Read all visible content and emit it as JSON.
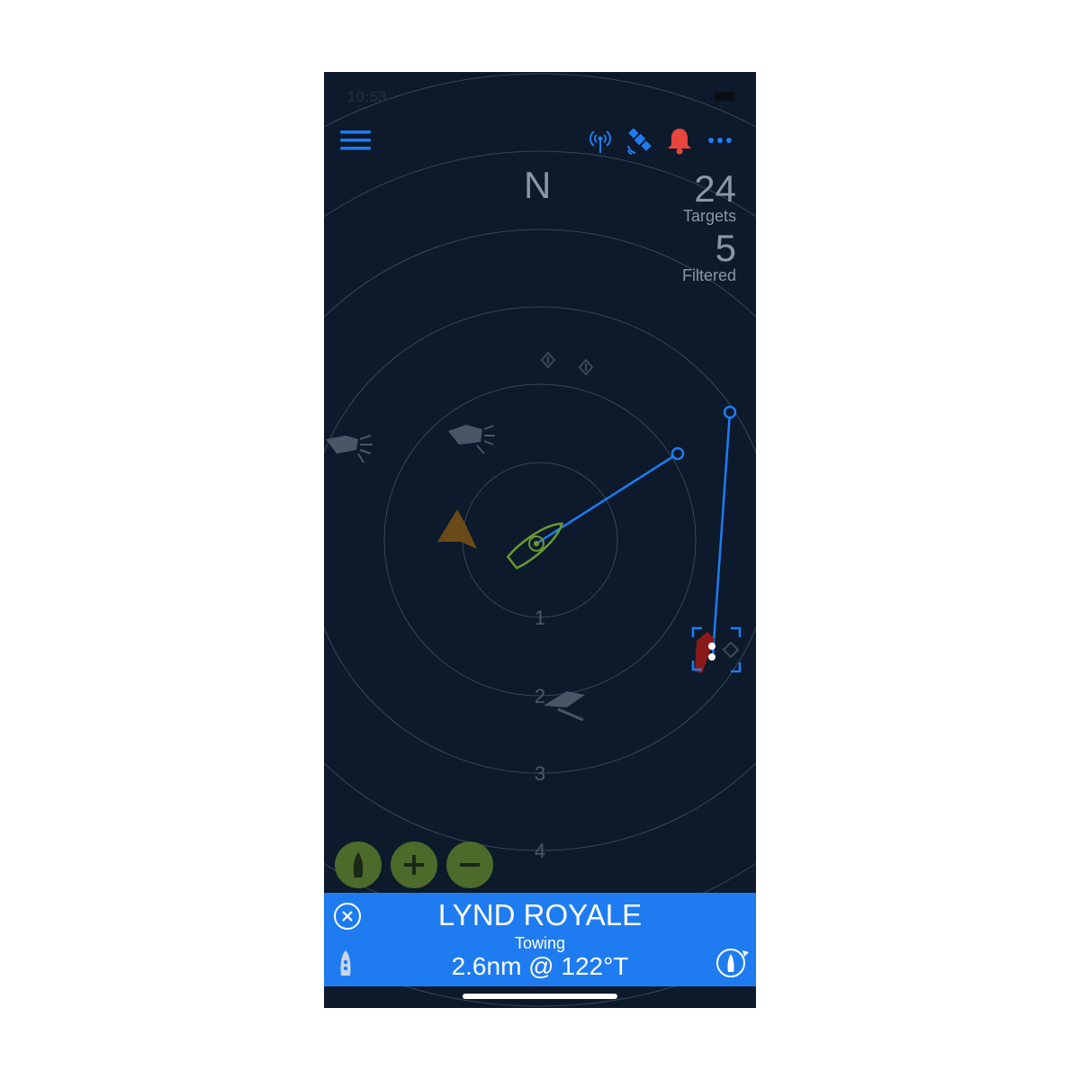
{
  "status_bar": {
    "time": "10:53"
  },
  "header": {
    "menu_icon": "hamburger-menu-icon",
    "ais_icon": "antenna-icon",
    "gps_icon": "satellite-icon",
    "alarm_icon": "bell-icon",
    "more_icon": "more-dots-icon"
  },
  "radar": {
    "heading_label": "N",
    "ring_labels": [
      "1",
      "2",
      "3",
      "4"
    ],
    "colors": {
      "background": "#0c1a2b",
      "ring": "#3a4657",
      "vector": "#1e7cf0",
      "own_ship": "#6a9a30",
      "target_faded": "#4a5566",
      "selected_target": "#8a1a1a",
      "sailboat": "#6a4a18"
    }
  },
  "counts": {
    "targets_value": "24",
    "targets_label": "Targets",
    "filtered_value": "5",
    "filtered_label": "Filtered"
  },
  "controls": {
    "center_icon": "own-boat-center-icon",
    "zoom_in_icon": "plus-icon",
    "zoom_out_icon": "minus-icon",
    "button_color": "#4c6a2a"
  },
  "target_panel": {
    "name": "LYND ROYALE",
    "type": "Towing",
    "range_bearing": "2.6nm @ 122°T",
    "close_icon": "close-circle-icon",
    "vessel_icon": "vessel-icon",
    "track_icon": "track-target-icon",
    "color": "#1e7cf0"
  }
}
